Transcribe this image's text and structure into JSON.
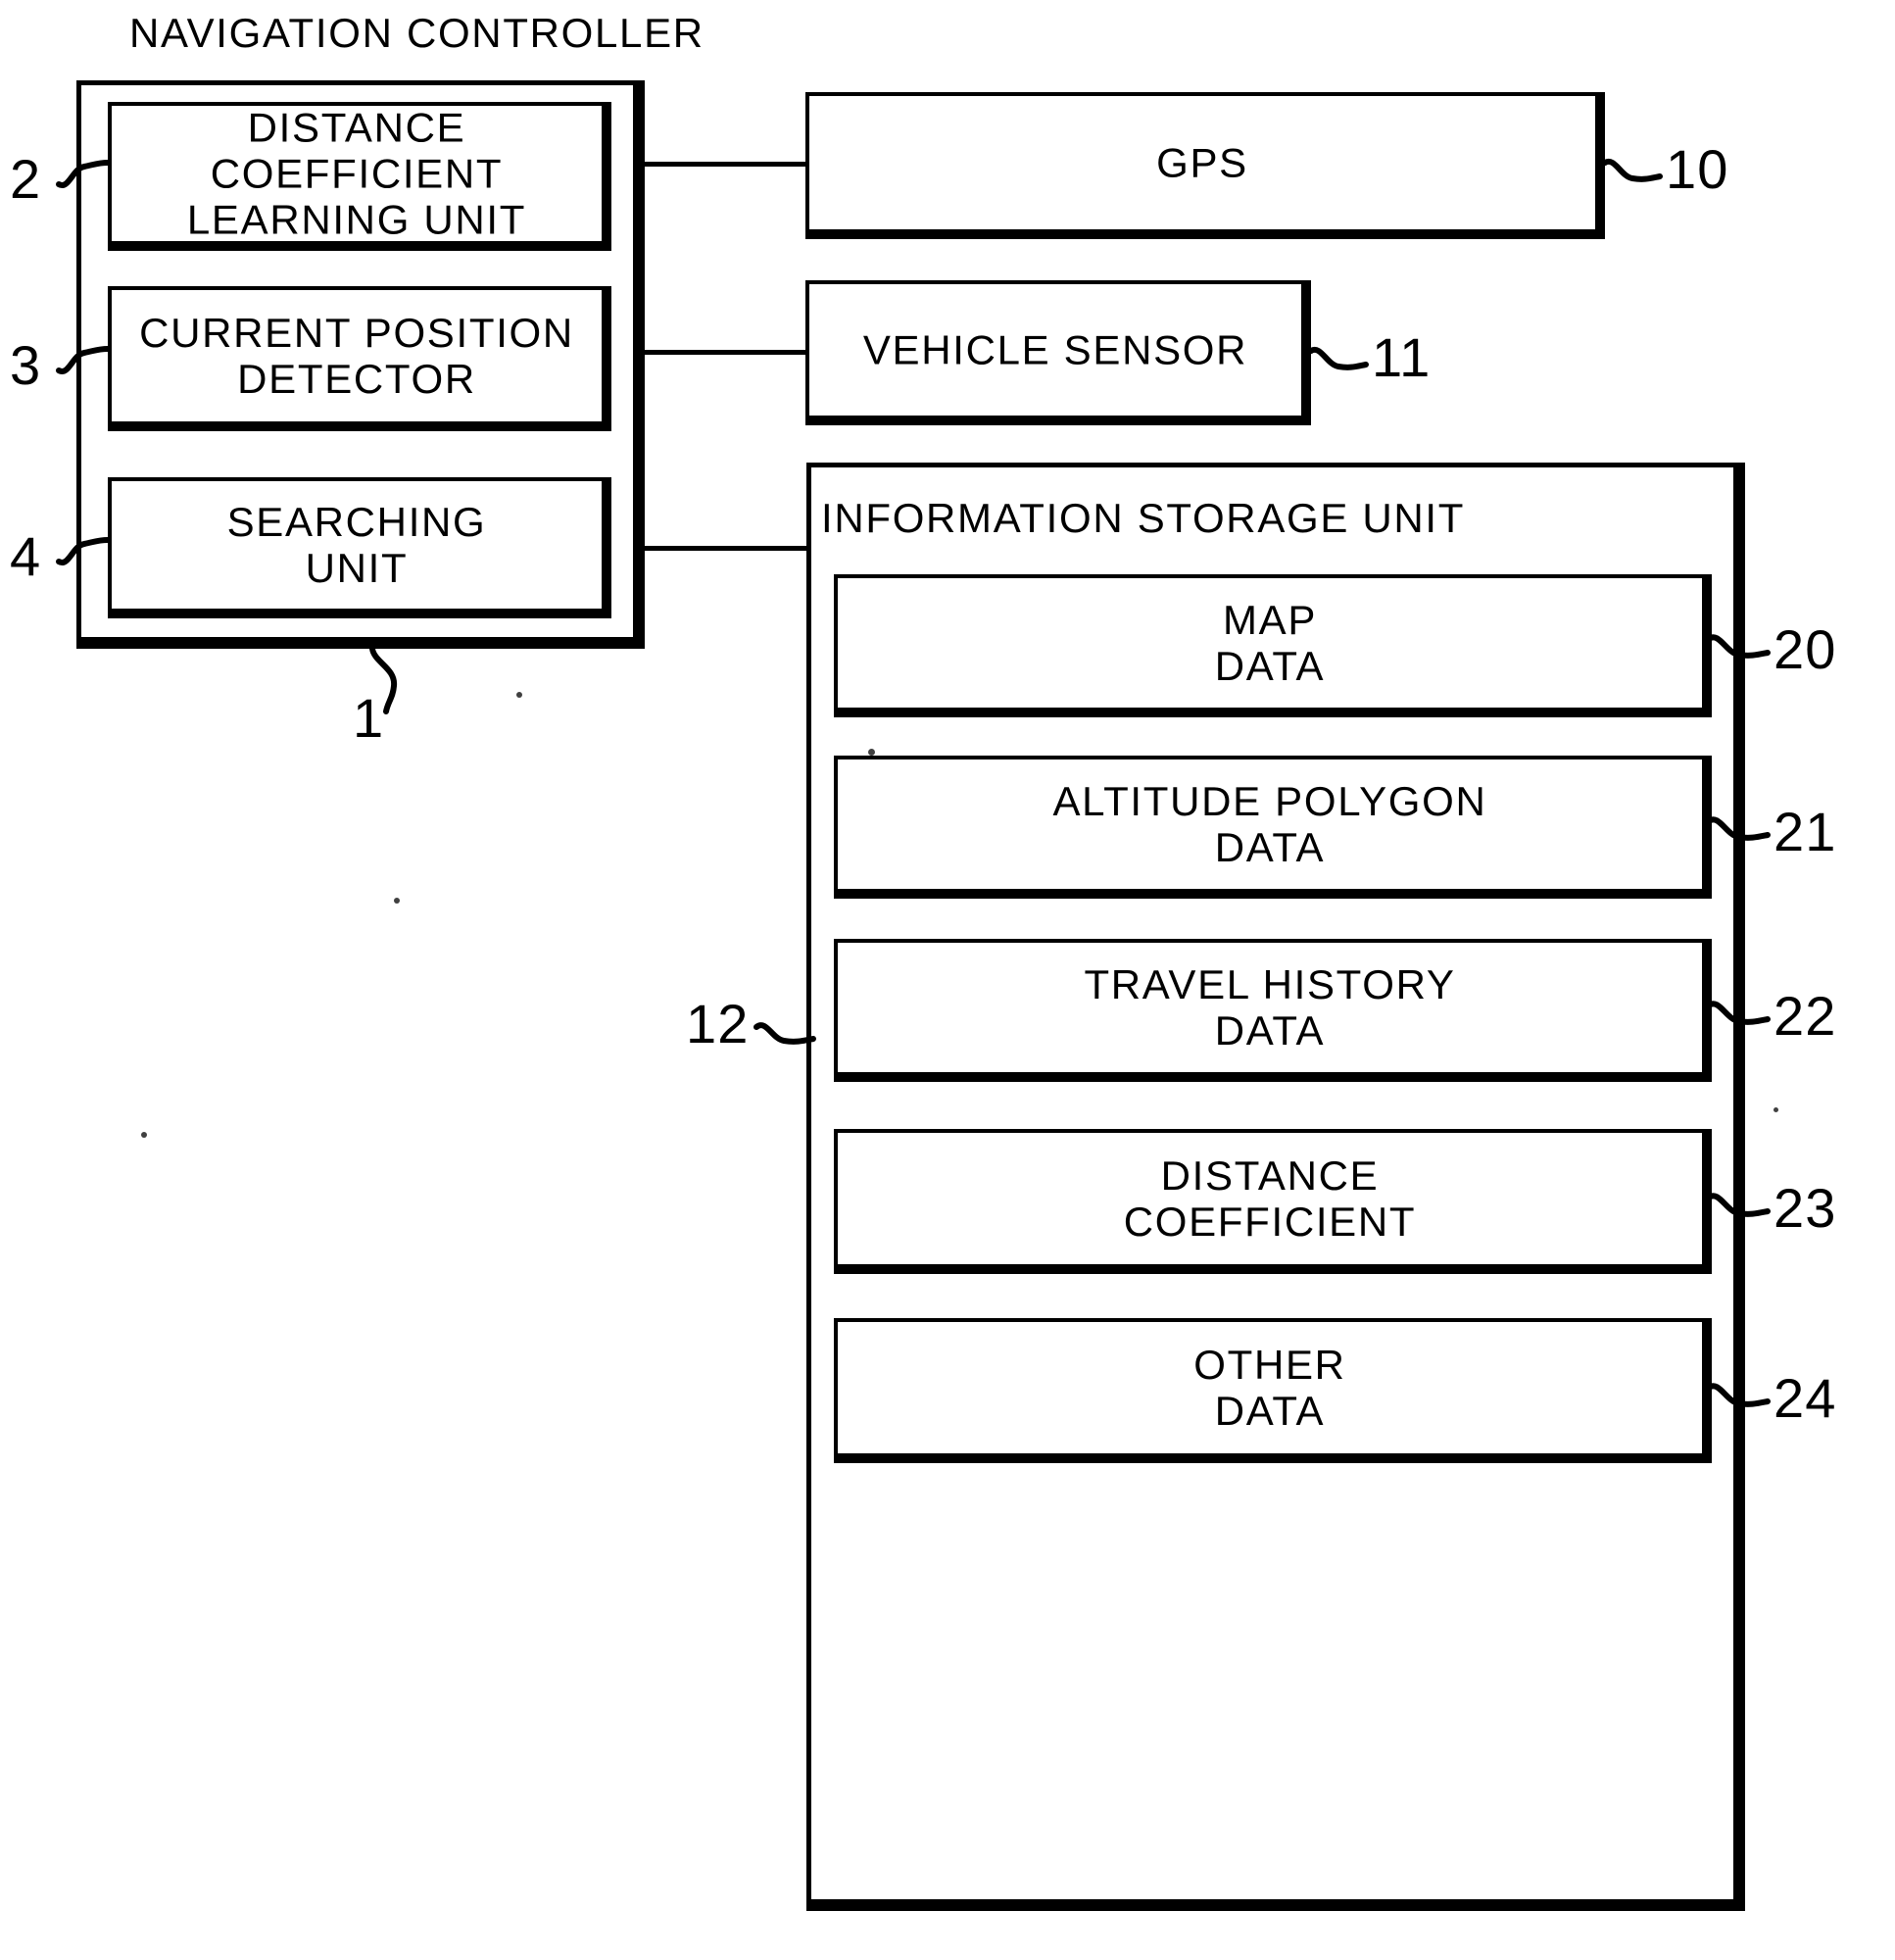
{
  "figure": {
    "title_navigation_controller": "NAVIGATION  CONTROLLER",
    "title_information_storage_unit": "INFORMATION  STORAGE  UNIT"
  },
  "navigation_controller": {
    "ref": "1",
    "modules": [
      {
        "ref": "2",
        "label": "DISTANCE  COEFFICIENT\nLEARNING  UNIT"
      },
      {
        "ref": "3",
        "label": "CURRENT  POSITION\nDETECTOR"
      },
      {
        "ref": "4",
        "label": "SEARCHING\nUNIT"
      }
    ]
  },
  "peripherals": [
    {
      "ref": "10",
      "label": "GPS"
    },
    {
      "ref": "11",
      "label": "VEHICLE  SENSOR"
    }
  ],
  "information_storage_unit": {
    "ref": "12",
    "data_blocks": [
      {
        "ref": "20",
        "label": "MAP\nDATA"
      },
      {
        "ref": "21",
        "label": "ALTITUDE  POLYGON\nDATA"
      },
      {
        "ref": "22",
        "label": "TRAVEL  HISTORY\nDATA"
      },
      {
        "ref": "23",
        "label": "DISTANCE\nCOEFFICIENT"
      },
      {
        "ref": "24",
        "label": "OTHER\nDATA"
      }
    ]
  },
  "colors": {
    "ink": "#000000",
    "paper": "#ffffff"
  }
}
